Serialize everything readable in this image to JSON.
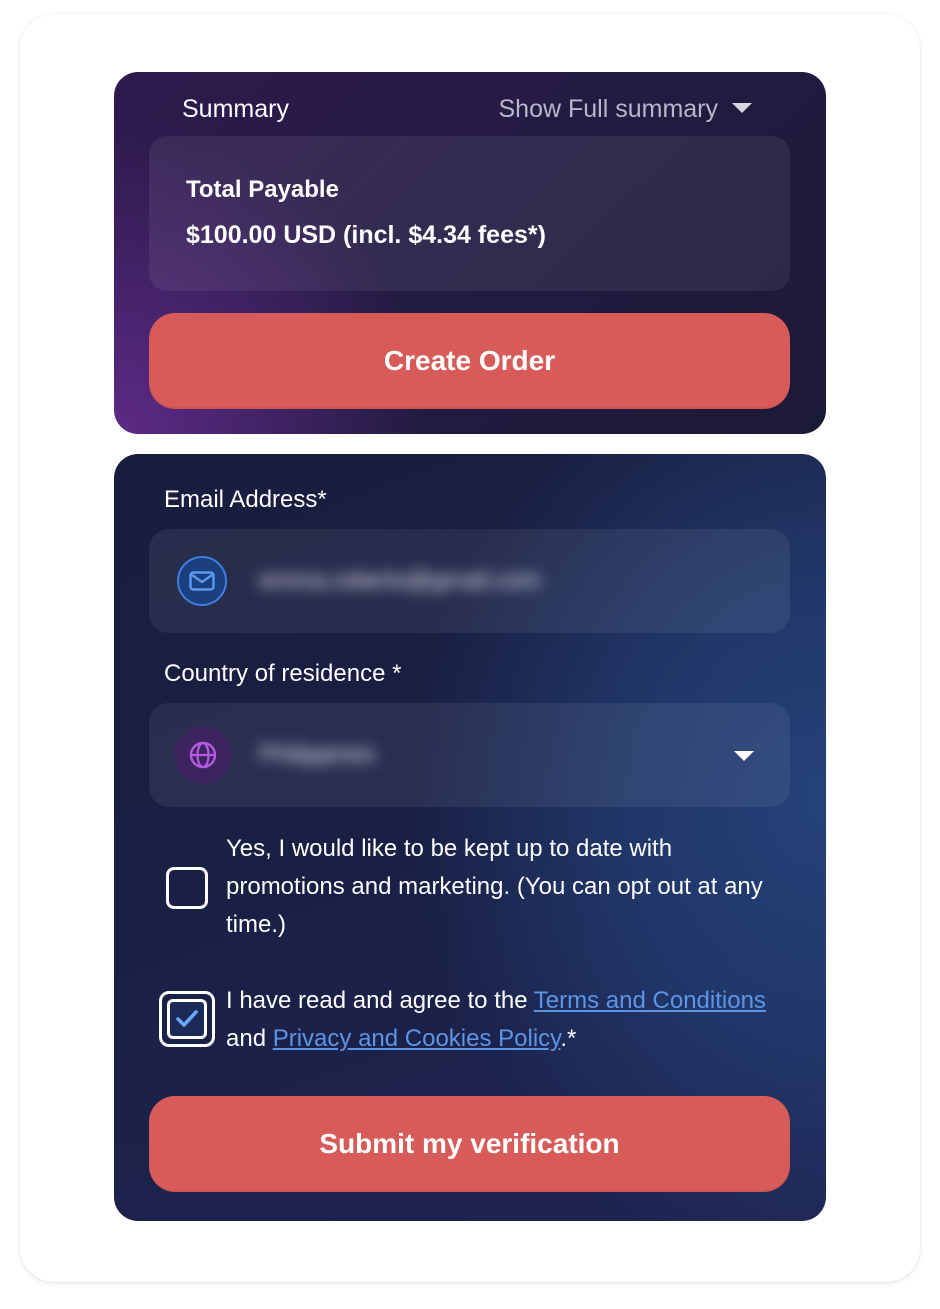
{
  "summary": {
    "title": "Summary",
    "toggle_label": "Show Full summary",
    "payable_label": "Total Payable",
    "payable_amount": "$100.00 USD (incl. $4.34 fees*)",
    "create_order_label": "Create Order"
  },
  "form": {
    "email_label": "Email Address*",
    "email_value": "emma.roberts@gmail.com",
    "country_label": "Country of residence *",
    "country_value": "Philippines",
    "marketing_checkbox": {
      "checked": false,
      "text": "Yes, I would like to be kept up to date with promotions and marketing. (You can opt out at any time.)"
    },
    "terms_checkbox": {
      "checked": true,
      "prefix": "I have read and agree to the ",
      "terms_link": "Terms and Conditions",
      "middle": " and ",
      "privacy_link": "Privacy and Cookies Policy",
      "suffix": ".*"
    },
    "submit_label": "Submit my verification"
  },
  "icons": {
    "email": "mail-icon",
    "country": "globe-icon",
    "summary_toggle": "caret-down-icon",
    "country_select": "caret-down-icon",
    "terms_check": "checkmark-icon"
  },
  "colors": {
    "accent_button": "#d75b58",
    "link": "#5c95e6",
    "mail_icon": "#3d7fe3",
    "globe_icon": "#b55ae0"
  }
}
